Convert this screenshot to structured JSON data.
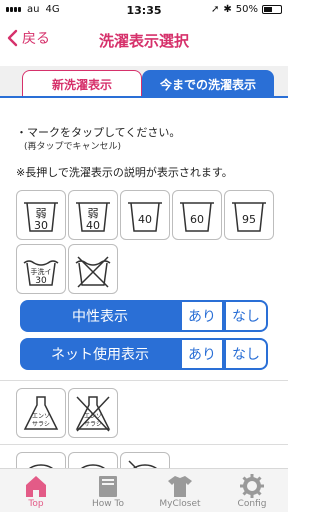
{
  "status_bar": {
    "carrier": "au",
    "network": "4G",
    "time": "13:35",
    "battery": "50%",
    "battery_level": 0.5
  },
  "nav": {
    "back_label": "戻る",
    "title": "洗濯表示選択"
  },
  "tabs": [
    {
      "label": "新洗濯表示",
      "active": false
    },
    {
      "label": "今までの洗濯表示",
      "active": true
    }
  ],
  "instructions": {
    "line1": "・マークをタップしてください。",
    "line2": "(再タップでキャンセル)",
    "note": "※長押しで洗濯表示の説明が表示されます。"
  },
  "symbols_row1": [
    {
      "top": "弱",
      "bottom": "30"
    },
    {
      "top": "弱",
      "bottom": "40"
    },
    {
      "top": "",
      "bottom": "40"
    },
    {
      "top": "",
      "bottom": "60"
    },
    {
      "top": "",
      "bottom": "95"
    }
  ],
  "symbols_row2": [
    {
      "top": "手洗イ",
      "bottom": "30"
    },
    {
      "top": "",
      "bottom": ""
    }
  ],
  "toggles": [
    {
      "label": "中性表示",
      "yes": "あり",
      "no": "なし"
    },
    {
      "label": "ネット使用表示",
      "yes": "あり",
      "no": "なし"
    }
  ],
  "symbols_row3": [
    {
      "line1": "エンソ",
      "line2": "サラシ"
    },
    {
      "line1": "エンソ",
      "line2": "サラシ"
    }
  ],
  "bottom_tabs": [
    {
      "label": "Top",
      "icon": "home-icon",
      "active": true
    },
    {
      "label": "How To",
      "icon": "book-icon",
      "active": false
    },
    {
      "label": "MyCloset",
      "icon": "shirt-icon",
      "active": false
    },
    {
      "label": "Config",
      "icon": "gear-icon",
      "active": false
    }
  ],
  "colors": {
    "accent_pink": "#d6316b",
    "accent_blue": "#2a6fd6",
    "tab_active_pink": "#e35b87"
  }
}
